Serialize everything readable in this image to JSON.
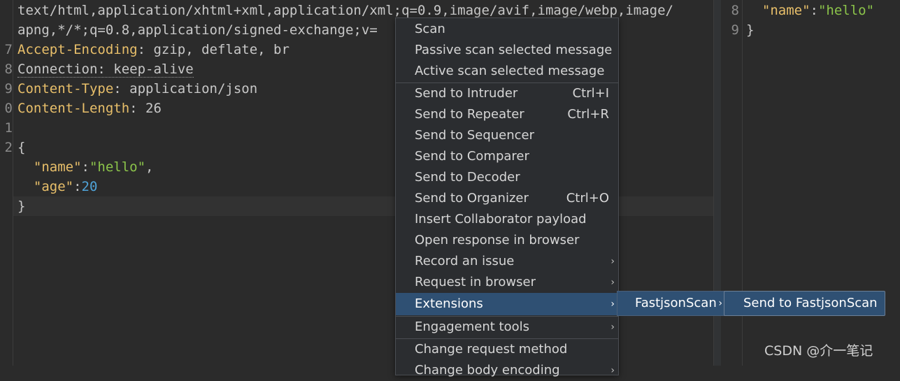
{
  "request_editor": {
    "lines": [
      {
        "num": "",
        "parts": [
          {
            "t": "text/html,application/xhtml+xml,application/xml;q=0.9,image/avif,image/webp,image/",
            "c": "plain"
          }
        ]
      },
      {
        "num": "",
        "parts": [
          {
            "t": "apng,*/*;q=0.8,application/signed-exchange;v=",
            "c": "plain"
          }
        ]
      },
      {
        "num": "7",
        "parts": [
          {
            "t": "Accept-Encoding",
            "c": "hdr"
          },
          {
            "t": ": gzip, deflate, br",
            "c": "plain"
          }
        ]
      },
      {
        "num": "8",
        "parts": [
          {
            "t": "Connection: keep-alive",
            "c": "dotted"
          }
        ]
      },
      {
        "num": "9",
        "parts": [
          {
            "t": "Content-Type",
            "c": "hdr"
          },
          {
            "t": ": application/json",
            "c": "plain"
          }
        ]
      },
      {
        "num": "0",
        "parts": [
          {
            "t": "Content-Length",
            "c": "hdr"
          },
          {
            "t": ": 26",
            "c": "plain"
          }
        ]
      },
      {
        "num": "1",
        "parts": []
      },
      {
        "num": "2",
        "parts": [
          {
            "t": "{",
            "c": "plain"
          }
        ]
      },
      {
        "num": "",
        "parts": [
          {
            "t": "  \"name\"",
            "c": "key"
          },
          {
            "t": ":",
            "c": "plain"
          },
          {
            "t": "\"hello\"",
            "c": "str"
          },
          {
            "t": ",",
            "c": "plain"
          }
        ]
      },
      {
        "num": "",
        "parts": [
          {
            "t": "  \"age\"",
            "c": "key"
          },
          {
            "t": ":",
            "c": "plain"
          },
          {
            "t": "20",
            "c": "num"
          }
        ]
      },
      {
        "num": "",
        "parts": [
          {
            "t": "}",
            "c": "plain"
          }
        ]
      }
    ]
  },
  "response_editor": {
    "lines": [
      {
        "num": "8",
        "parts": [
          {
            "t": "  \"name\"",
            "c": "key"
          },
          {
            "t": ":",
            "c": "plain"
          },
          {
            "t": "\"hello\"",
            "c": "str"
          }
        ]
      },
      {
        "num": "9",
        "parts": [
          {
            "t": "}",
            "c": "plain"
          }
        ]
      }
    ]
  },
  "context_menu": {
    "groups": [
      [
        {
          "label": "Scan",
          "shortcut": "",
          "submenu": false
        },
        {
          "label": "Passive scan selected message",
          "shortcut": "",
          "submenu": false
        },
        {
          "label": "Active scan selected message",
          "shortcut": "",
          "submenu": false
        }
      ],
      [
        {
          "label": "Send to Intruder",
          "shortcut": "Ctrl+I",
          "submenu": false
        },
        {
          "label": "Send to Repeater",
          "shortcut": "Ctrl+R",
          "submenu": false
        },
        {
          "label": "Send to Sequencer",
          "shortcut": "",
          "submenu": false
        },
        {
          "label": "Send to Comparer",
          "shortcut": "",
          "submenu": false
        },
        {
          "label": "Send to Decoder",
          "shortcut": "",
          "submenu": false
        },
        {
          "label": "Send to Organizer",
          "shortcut": "Ctrl+O",
          "submenu": false
        },
        {
          "label": "Insert Collaborator payload",
          "shortcut": "",
          "submenu": false
        },
        {
          "label": "Open response in browser",
          "shortcut": "",
          "submenu": false
        },
        {
          "label": "Record an issue",
          "shortcut": "",
          "submenu": true
        },
        {
          "label": "Request in browser",
          "shortcut": "",
          "submenu": true
        },
        {
          "label": "Extensions",
          "shortcut": "",
          "submenu": true,
          "active": true
        }
      ],
      [
        {
          "label": "Engagement tools",
          "shortcut": "",
          "submenu": true
        }
      ],
      [
        {
          "label": "Change request method",
          "shortcut": "",
          "submenu": false
        },
        {
          "label": "Change body encoding",
          "shortcut": "",
          "submenu": true
        }
      ]
    ]
  },
  "submenu_extensions": {
    "label": "FastjsonScan",
    "arrow": "›"
  },
  "submenu_fastjson": {
    "label": "Send to FastjsonScan"
  },
  "watermark": "CSDN @介一笔记",
  "colors": {
    "active_bg": "#2f5073",
    "key": "#e8bf6a",
    "string": "#8bc34a",
    "number": "#4fa3d8"
  }
}
